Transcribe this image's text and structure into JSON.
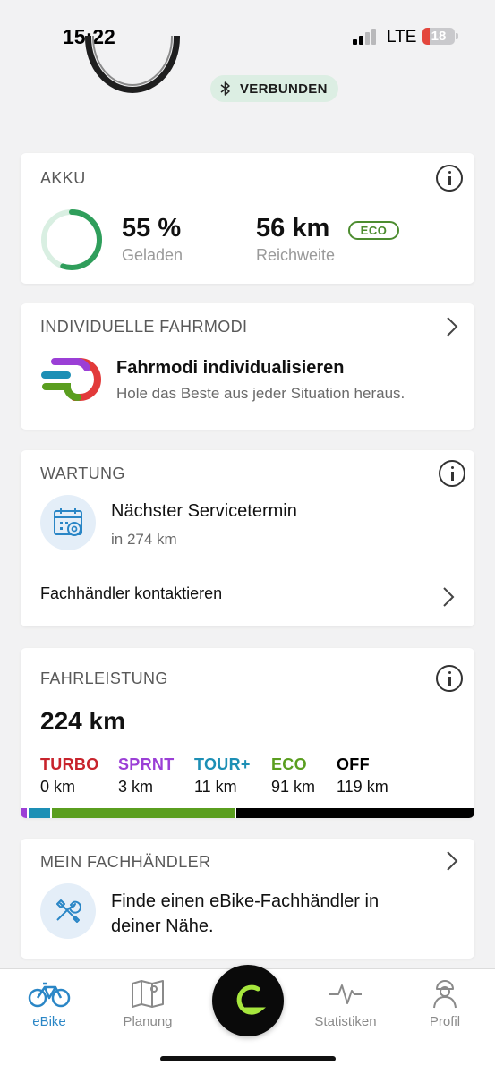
{
  "status_bar": {
    "time": "15:22",
    "network": "LTE",
    "battery_level": "18"
  },
  "bike": {
    "connection_status": "VERBUNDEN"
  },
  "akku": {
    "title": "AKKU",
    "charge_value": "55 %",
    "charge_label": "Geladen",
    "charge_fraction": 0.55,
    "range_value": "56 km",
    "range_label": "Reichweite",
    "mode_badge": "ECO"
  },
  "fahrmodi": {
    "title": "INDIVIDUELLE FAHRMODI",
    "item_title": "Fahrmodi individualisieren",
    "item_subtitle": "Hole das Beste aus jeder Situation heraus."
  },
  "wartung": {
    "title": "WARTUNG",
    "service_title": "Nächster Servicetermin",
    "service_subtitle": "in 274 km",
    "contact_link": "Fachhändler kontaktieren"
  },
  "fahrleistung": {
    "title": "FAHRLEISTUNG",
    "total": "224 km",
    "modes": [
      {
        "name": "TURBO",
        "value": "0 km",
        "km": 0,
        "color": "#c8232c"
      },
      {
        "name": "SPRNT",
        "value": "3 km",
        "km": 3,
        "color": "#9b3fd6"
      },
      {
        "name": "TOUR+",
        "value": "11 km",
        "km": 11,
        "color": "#1d8fb5"
      },
      {
        "name": "ECO",
        "value": "91 km",
        "km": 91,
        "color": "#5a9e1f"
      },
      {
        "name": "OFF",
        "value": "119 km",
        "km": 119,
        "color": "#000000"
      }
    ]
  },
  "fachhaendler": {
    "title": "MEIN FACHHÄNDLER",
    "text": "Finde einen eBike-Fachhändler in deiner Nähe."
  },
  "tabs": [
    {
      "label": "eBike",
      "icon": "bike-icon",
      "active": true
    },
    {
      "label": "Planung",
      "icon": "map-icon",
      "active": false
    },
    {
      "label": "Statistiken",
      "icon": "activity-icon",
      "active": false
    },
    {
      "label": "Profil",
      "icon": "profile-icon",
      "active": false
    }
  ],
  "colors": {
    "accent_green": "#2f9e5b",
    "accent_blue": "#2a86c6"
  }
}
